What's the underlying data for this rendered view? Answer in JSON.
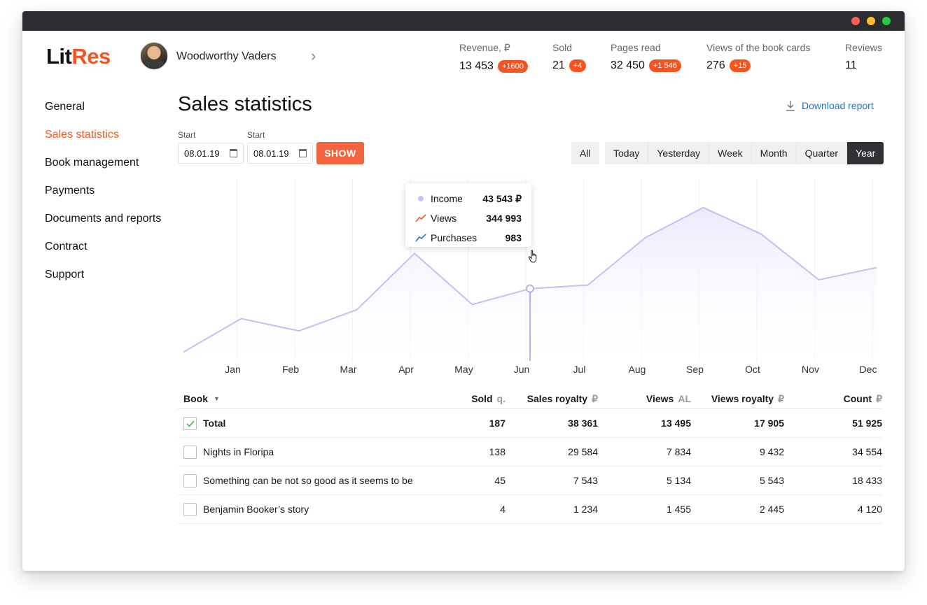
{
  "brand": {
    "part1": "Lit",
    "part2": "Res"
  },
  "user": {
    "name": "Woodworthy Vaders"
  },
  "stats": [
    {
      "label": "Revenue, ₽",
      "value": "13 453",
      "badge": "+1600"
    },
    {
      "label": "Sold",
      "value": "21",
      "badge": "+4"
    },
    {
      "label": "Pages read",
      "value": "32 450",
      "badge": "+1 546"
    },
    {
      "label": "Views of the book cards",
      "value": "276",
      "badge": "+15"
    },
    {
      "label": "Reviews",
      "value": "11",
      "badge": ""
    }
  ],
  "nav": {
    "items": [
      {
        "label": "General"
      },
      {
        "label": "Sales statistics",
        "active": true
      },
      {
        "label": "Book management"
      },
      {
        "label": "Payments"
      },
      {
        "label": "Documents and reports"
      },
      {
        "label": "Contract"
      },
      {
        "label": "Support"
      }
    ]
  },
  "page": {
    "title": "Sales statistics",
    "download_label": "Download report"
  },
  "filters": {
    "start_label_1": "Start",
    "start_value_1": "08.01.19",
    "start_label_2": "Start",
    "start_value_2": "08.01.19",
    "show_label": "SHOW",
    "periods": [
      "All",
      "Today",
      "Yesterday",
      "Week",
      "Month",
      "Quarter",
      "Year"
    ],
    "active_period": "Year"
  },
  "tooltip": {
    "rows": [
      {
        "name": "Income",
        "value": "43 543 ₽"
      },
      {
        "name": "Views",
        "value": "344 993"
      },
      {
        "name": "Purchases",
        "value": "983"
      }
    ]
  },
  "chart_data": {
    "type": "area",
    "categories": [
      "Jan",
      "Feb",
      "Mar",
      "Apr",
      "May",
      "Jun",
      "Jul",
      "Aug",
      "Sep",
      "Oct",
      "Nov",
      "Dec"
    ],
    "series": [
      {
        "values": [
          5,
          24,
          17,
          29,
          61,
          32,
          41,
          43,
          70,
          87,
          72,
          46,
          53
        ]
      }
    ],
    "ylim": [
      0,
      100
    ],
    "highlight_index": 6,
    "colors": {
      "line": "#c5bff4",
      "fill_top": "#ece9fd",
      "grid": "#efefef"
    },
    "grid": true,
    "legend": "tooltip"
  },
  "table": {
    "headers": {
      "book": "Book",
      "sold": "Sold",
      "sold_unit": "q.",
      "sales_royalty": "Sales royalty",
      "sales_royalty_unit": "₽",
      "views": "Views",
      "views_unit": "AL",
      "views_royalty": "Views royalty",
      "views_royalty_unit": "₽",
      "count": "Count",
      "count_unit": "₽"
    },
    "rows": [
      {
        "book": "Total",
        "checked": true,
        "bold": true,
        "sold": "187",
        "sales_royalty": "38 361",
        "views": "13 495",
        "views_royalty": "17 905",
        "count": "51 925"
      },
      {
        "book": "Nights in Floripa",
        "checked": false,
        "sold": "138",
        "sales_royalty": "29 584",
        "views": "7 834",
        "views_royalty": "9 432",
        "count": "34 554"
      },
      {
        "book": "Something can be not so good as it seems to be",
        "checked": false,
        "sold": "45",
        "sales_royalty": "7 543",
        "views": "5 134",
        "views_royalty": "5 543",
        "count": "18 433"
      },
      {
        "book": "Benjamin Booker’s story",
        "checked": false,
        "sold": "4",
        "sales_royalty": "1 234",
        "views": "1 455",
        "views_royalty": "2 445",
        "count": "4 120"
      }
    ]
  }
}
